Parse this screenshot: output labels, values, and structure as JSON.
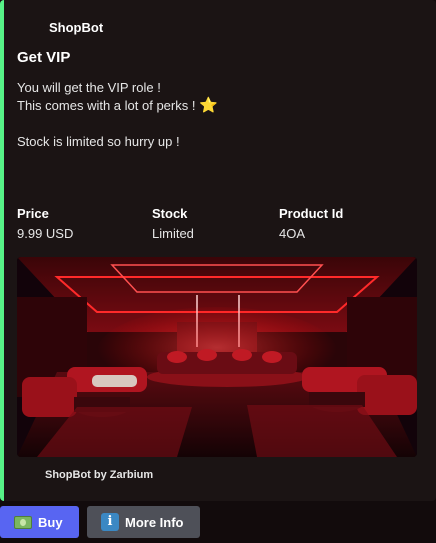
{
  "embed": {
    "author": "ShopBot",
    "title": "Get VIP",
    "description": {
      "line1": "You will get the VIP role !",
      "line2": "This comes with a lot of perks !",
      "line2_emoji": "⭐",
      "line3": "Stock is limited so hurry up !"
    },
    "fields": [
      {
        "name": "Price",
        "value": "9.99 USD"
      },
      {
        "name": "Stock",
        "value": "Limited"
      },
      {
        "name": "Product Id",
        "value": "4OA"
      }
    ],
    "footer": "ShopBot by Zarbium",
    "accent_color": "#57f287"
  },
  "buttons": {
    "buy": {
      "label": "Buy",
      "icon": "dollar-banknote-icon",
      "color": "#5865f2"
    },
    "more_info": {
      "label": "More Info",
      "icon": "information-icon",
      "icon_glyph": "i",
      "color": "#4e5058"
    }
  }
}
